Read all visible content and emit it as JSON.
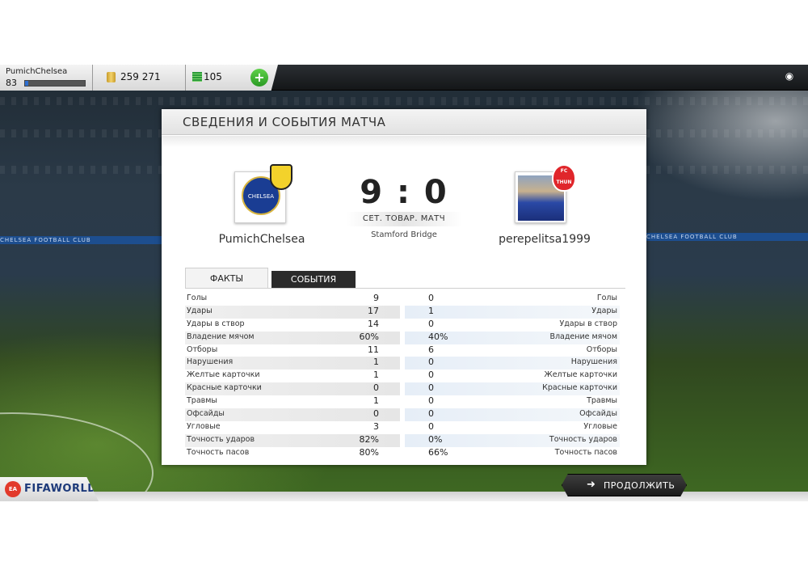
{
  "topbar": {
    "username": "PumichChelsea",
    "level": "83",
    "xp_progress": 0.05,
    "coins": "259 271",
    "points": "105",
    "add_label": "+"
  },
  "background": {
    "banner_text": "CHELSEA FOOTBALL CLUB"
  },
  "panel": {
    "title": "СВЕДЕНИЯ И СОБЫТИЯ МАТЧА",
    "home_team": "PumichChelsea",
    "away_team": "perepelitsa1999",
    "score": "9 : 0",
    "match_type": "СЕТ. ТОВАР. МАТЧ",
    "venue": "Stamford Bridge",
    "home_crest_text": "CHELSEA",
    "away_badge_text": "FC THUN",
    "tabs": [
      {
        "label": "ФАКТЫ",
        "active": true
      },
      {
        "label": "СОБЫТИЯ",
        "active": false
      }
    ]
  },
  "stats": [
    {
      "name": "Голы",
      "home": "9",
      "away": "0"
    },
    {
      "name": "Удары",
      "home": "17",
      "away": "1"
    },
    {
      "name": "Удары в створ",
      "home": "14",
      "away": "0"
    },
    {
      "name": "Владение мячом",
      "home": "60%",
      "away": "40%"
    },
    {
      "name": "Отборы",
      "home": "11",
      "away": "6"
    },
    {
      "name": "Нарушения",
      "home": "1",
      "away": "0"
    },
    {
      "name": "Желтые карточки",
      "home": "1",
      "away": "0"
    },
    {
      "name": "Красные карточки",
      "home": "0",
      "away": "0"
    },
    {
      "name": "Травмы",
      "home": "1",
      "away": "0"
    },
    {
      "name": "Офсайды",
      "home": "0",
      "away": "0"
    },
    {
      "name": "Угловые",
      "home": "3",
      "away": "0"
    },
    {
      "name": "Точность ударов",
      "home": "82%",
      "away": "0%"
    },
    {
      "name": "Точность пасов",
      "home": "80%",
      "away": "66%"
    }
  ],
  "footer": {
    "brand": "FIFAWORLD",
    "ea_label": "EA",
    "continue_label": "ПРОДОЛЖИТЬ"
  },
  "colors": {
    "accent_green": "#3bb53a",
    "tab_dark": "#2b2b2b",
    "xp_blue": "#2e6fd1"
  }
}
